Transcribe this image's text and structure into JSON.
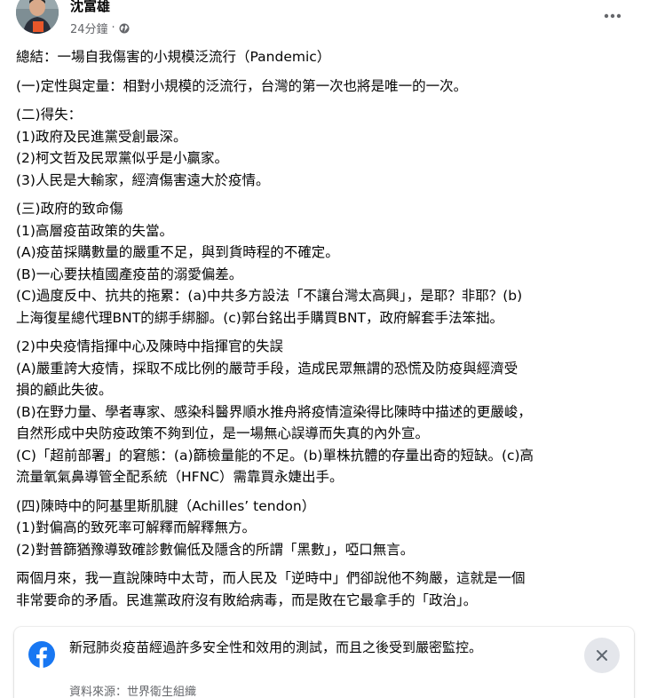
{
  "post": {
    "author": "沈富雄",
    "time": "24分鐘",
    "dot": "·",
    "paragraphs": [
      [
        "總結：一場自我傷害的小規模泛流行（Pandemic）"
      ],
      [
        "(一)定性與定量：相對小規模的泛流行，台灣的第一次也將是唯一的一次。"
      ],
      [
        "(二)得失：",
        "(1)政府及民進黨受創最深。",
        "(2)柯文哲及民眾黨似乎是小贏家。",
        "(3)人民是大輸家，經濟傷害遠大於疫情。"
      ],
      [
        "(三)政府的致命傷",
        "(1)高層疫苗政策的失當。",
        "(A)疫苗採購數量的嚴重不足，與到貨時程的不確定。",
        "(B)一心要扶植國產疫苗的溺愛偏差。",
        "(C)過度反中、抗共的拖累：(a)中共多方設法「不讓台灣太高興」，是耶？非耶？(b)",
        "上海復星總代理BNT的綁手綁腳。(c)郭台銘出手購買BNT，政府解套手法笨拙。"
      ],
      [
        "(2)中央疫情指揮中心及陳時中指揮官的失誤",
        "(A)嚴重誇大疫情，採取不成比例的嚴苛手段，造成民眾無謂的恐慌及防疫與經濟受",
        "損的顧此失彼。",
        "(B)在野力量、學者專家、感染科醫界順水推舟將疫情渲染得比陳時中描述的更嚴峻，",
        "自然形成中央防疫政策不夠到位，是一場無心誤導而失真的內外宣。",
        "(C)「超前部署」的窘態：(a)篩檢量能的不足。(b)單株抗體的存量出奇的短缺。(c)高",
        "流量氧氣鼻導管全配系統（HFNC）需靠買永婕出手。"
      ],
      [
        "(四)陳時中的阿基里斯肌腱（Achilles’ tendon）",
        "(1)對偏高的致死率可解釋而解釋無方。",
        "(2)對普篩猶豫導致確診數偏低及隱含的所謂「黑數」，啞口無言。"
      ],
      [
        "兩個月來，我一直說陳時中太苛，而人民及「逆時中」們卻說他不夠嚴，這就是一個",
        "非常要命的矛盾。民進黨政府沒有敗給病毒，而是敗在它最拿手的「政治」。"
      ]
    ]
  },
  "card": {
    "text": "新冠肺炎疫苗經過許多安全性和效用的測試，而且之後受到嚴密監控。",
    "source": "資料來源：世界衛生組織"
  },
  "icons": {
    "more": "more-options-icon",
    "globe": "globe-icon",
    "facebook": "facebook-logo-icon",
    "close": "close-icon"
  },
  "colors": {
    "text": "#050505",
    "secondary": "#65676b",
    "facebook_blue": "#1877f2",
    "button_bg": "#e4e6eb"
  }
}
